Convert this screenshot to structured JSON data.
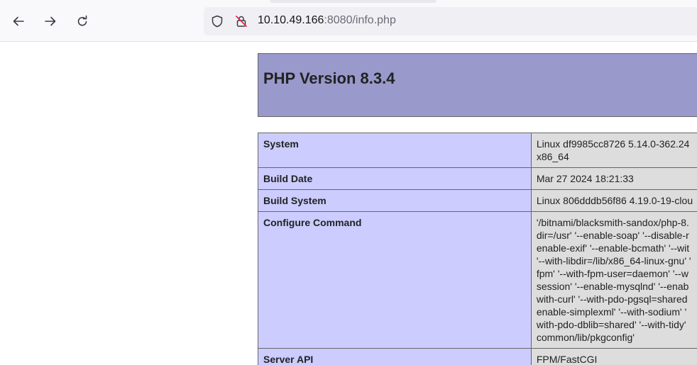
{
  "browser": {
    "url_host": "10.10.49.166",
    "url_rest": ":8080/info.php"
  },
  "page": {
    "heading": "PHP Version 8.3.4",
    "rows": [
      {
        "key": "System",
        "value_lines": [
          "Linux df9985cc8726 5.14.0-362.24",
          "x86_64"
        ]
      },
      {
        "key": "Build Date",
        "value_lines": [
          "Mar 27 2024 18:21:33"
        ]
      },
      {
        "key": "Build System",
        "value_lines": [
          "Linux 806dddb56f86 4.19.0-19-clou"
        ]
      },
      {
        "key": "Configure Command",
        "value_lines": [
          "'/bitnami/blacksmith-sandox/php-8.",
          "dir=/usr' '--enable-soap' '--disable-r",
          "enable-exif' '--enable-bcmath' '--wit",
          "'--with-libdir=/lib/x86_64-linux-gnu' '",
          "fpm' '--with-fpm-user=daemon' '--w",
          "session' '--enable-mysqlnd' '--enab",
          "with-curl' '--with-pdo-pgsql=shared",
          "enable-simplexml' '--with-sodium' '",
          "with-pdo-dblib=shared' '--with-tidy'",
          "common/lib/pkgconfig'"
        ]
      },
      {
        "key": "Server API",
        "value_lines": [
          "FPM/FastCGI"
        ]
      }
    ]
  }
}
